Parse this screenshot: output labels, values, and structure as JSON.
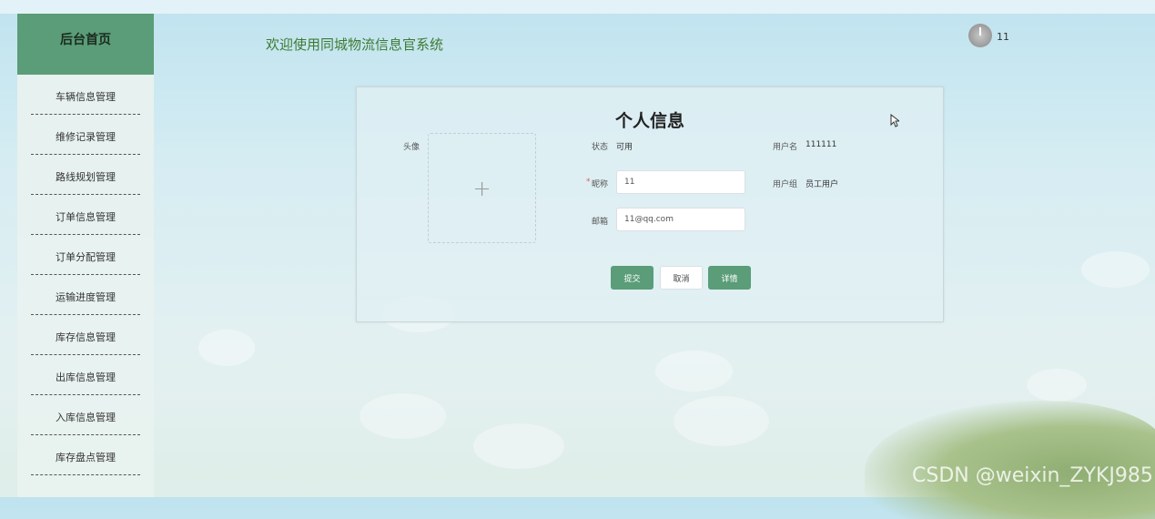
{
  "sidebar": {
    "brand": "后台首页",
    "items": [
      {
        "label": "车辆信息管理"
      },
      {
        "label": "维修记录管理"
      },
      {
        "label": "路线规划管理"
      },
      {
        "label": "订单信息管理"
      },
      {
        "label": "订单分配管理"
      },
      {
        "label": "运输进度管理"
      },
      {
        "label": "库存信息管理"
      },
      {
        "label": "出库信息管理"
      },
      {
        "label": "入库信息管理"
      },
      {
        "label": "库存盘点管理"
      }
    ]
  },
  "header": {
    "welcome": "欢迎使用同城物流信息官系统",
    "user_name": "11"
  },
  "form": {
    "title": "个人信息",
    "avatar_label": "头像",
    "upload_icon": "+",
    "status_label": "状态",
    "status_value": "可用",
    "username_label": "用户名",
    "username_value": "111111",
    "nickname_label": "昵称",
    "nickname_required": "*",
    "nickname_value": "11",
    "group_label": "用户组",
    "group_value": "员工用户",
    "email_label": "邮箱",
    "email_value": "11@qq.com",
    "submit": "提交",
    "cancel": "取消",
    "details": "详情"
  },
  "watermark": "CSDN @weixin_ZYKJ985",
  "colors": {
    "accent": "#5a9d78",
    "welcome_text": "#3f7a33"
  }
}
